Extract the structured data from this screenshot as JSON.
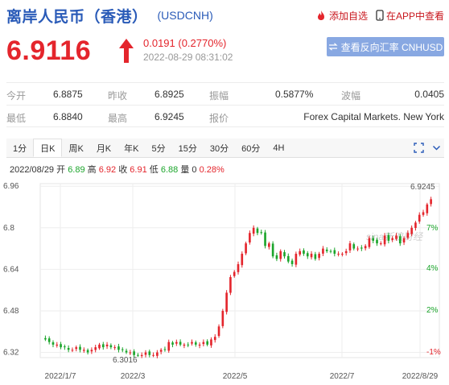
{
  "header": {
    "title": "离岸人民币（香港）",
    "code": "(USDCNH)",
    "add_watchlist": "添加自选",
    "open_in_app": "在APP中查看"
  },
  "quote": {
    "price": "6.9116",
    "change": "0.0191 (0.2770%)",
    "timestamp": "2022-08-29 08:31:02",
    "reverse_button": "查看反向汇率 CNHUSD"
  },
  "stats": {
    "open_label": "今开",
    "open_value": "6.8875",
    "prev_close_label": "昨收",
    "prev_close_value": "6.8925",
    "amplitude_label": "振幅",
    "amplitude_value": "0.5877%",
    "volatility_label": "波幅",
    "volatility_value": "0.0405",
    "low_label": "最低",
    "low_value": "6.8840",
    "high_label": "最高",
    "high_value": "6.9245",
    "quote_source_label": "报价",
    "quote_source_value": "Forex Capital Markets. New York"
  },
  "tabs": [
    "1分",
    "日K",
    "周K",
    "月K",
    "年K",
    "5分",
    "15分",
    "30分",
    "60分",
    "4H"
  ],
  "active_tab": "日K",
  "ohlc_line": {
    "date": "2022/08/29",
    "open_label": "开",
    "open": "6.89",
    "high_label": "高",
    "high": "6.92",
    "close_label": "收",
    "close": "6.91",
    "low_label": "低",
    "low": "6.88",
    "volume_label": "量",
    "volume": "0",
    "change_pct": "0.28%"
  },
  "colors": {
    "up": "#e4252c",
    "down": "#1ba52b",
    "accent": "#2a5bb8",
    "button": "#88a8e2"
  },
  "chart_data": {
    "type": "candlestick",
    "y_ticks": [
      "6.96",
      "6.8",
      "6.64",
      "6.48",
      "6.32"
    ],
    "y_tick_values": [
      6.96,
      6.8,
      6.64,
      6.48,
      6.32
    ],
    "pct_ticks": [
      "7%",
      "4%",
      "2%",
      "-1%"
    ],
    "x_ticks": [
      "2022/1/7",
      "2022/3",
      "2022/5",
      "2022/7",
      "2022/8/29"
    ],
    "ylim": [
      6.3,
      6.97
    ],
    "max_label": "6.9245",
    "min_label": "6.3016",
    "watermark": "sina新浪财经",
    "series_close": [
      6.37,
      6.36,
      6.35,
      6.35,
      6.34,
      6.34,
      6.33,
      6.33,
      6.34,
      6.33,
      6.33,
      6.32,
      6.33,
      6.34,
      6.35,
      6.34,
      6.35,
      6.34,
      6.34,
      6.33,
      6.33,
      6.32,
      6.32,
      6.31,
      6.31,
      6.31,
      6.32,
      6.31,
      6.31,
      6.32,
      6.33,
      6.33,
      6.36,
      6.35,
      6.36,
      6.35,
      6.35,
      6.35,
      6.36,
      6.35,
      6.35,
      6.36,
      6.35,
      6.37,
      6.38,
      6.42,
      6.48,
      6.55,
      6.61,
      6.63,
      6.66,
      6.7,
      6.74,
      6.78,
      6.8,
      6.78,
      6.78,
      6.73,
      6.74,
      6.69,
      6.68,
      6.71,
      6.69,
      6.67,
      6.66,
      6.7,
      6.71,
      6.7,
      6.69,
      6.7,
      6.68,
      6.7,
      6.72,
      6.71,
      6.71,
      6.7,
      6.7,
      6.7,
      6.71,
      6.74,
      6.72,
      6.72,
      6.72,
      6.73,
      6.76,
      6.75,
      6.74,
      6.74,
      6.77,
      6.75,
      6.76,
      6.77,
      6.74,
      6.76,
      6.78,
      6.8,
      6.82,
      6.85,
      6.86,
      6.89,
      6.91
    ]
  }
}
